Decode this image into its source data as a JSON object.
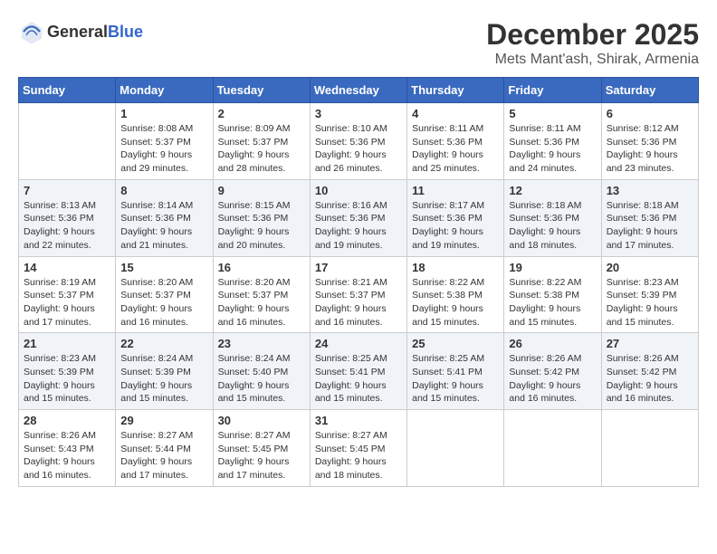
{
  "logo": {
    "general": "General",
    "blue": "Blue"
  },
  "title": "December 2025",
  "subtitle": "Mets Mant'ash, Shirak, Armenia",
  "days_of_week": [
    "Sunday",
    "Monday",
    "Tuesday",
    "Wednesday",
    "Thursday",
    "Friday",
    "Saturday"
  ],
  "weeks": [
    [
      {
        "day": "",
        "sunrise": "",
        "sunset": "",
        "daylight": ""
      },
      {
        "day": "1",
        "sunrise": "Sunrise: 8:08 AM",
        "sunset": "Sunset: 5:37 PM",
        "daylight": "Daylight: 9 hours and 29 minutes."
      },
      {
        "day": "2",
        "sunrise": "Sunrise: 8:09 AM",
        "sunset": "Sunset: 5:37 PM",
        "daylight": "Daylight: 9 hours and 28 minutes."
      },
      {
        "day": "3",
        "sunrise": "Sunrise: 8:10 AM",
        "sunset": "Sunset: 5:36 PM",
        "daylight": "Daylight: 9 hours and 26 minutes."
      },
      {
        "day": "4",
        "sunrise": "Sunrise: 8:11 AM",
        "sunset": "Sunset: 5:36 PM",
        "daylight": "Daylight: 9 hours and 25 minutes."
      },
      {
        "day": "5",
        "sunrise": "Sunrise: 8:11 AM",
        "sunset": "Sunset: 5:36 PM",
        "daylight": "Daylight: 9 hours and 24 minutes."
      },
      {
        "day": "6",
        "sunrise": "Sunrise: 8:12 AM",
        "sunset": "Sunset: 5:36 PM",
        "daylight": "Daylight: 9 hours and 23 minutes."
      }
    ],
    [
      {
        "day": "7",
        "sunrise": "Sunrise: 8:13 AM",
        "sunset": "Sunset: 5:36 PM",
        "daylight": "Daylight: 9 hours and 22 minutes."
      },
      {
        "day": "8",
        "sunrise": "Sunrise: 8:14 AM",
        "sunset": "Sunset: 5:36 PM",
        "daylight": "Daylight: 9 hours and 21 minutes."
      },
      {
        "day": "9",
        "sunrise": "Sunrise: 8:15 AM",
        "sunset": "Sunset: 5:36 PM",
        "daylight": "Daylight: 9 hours and 20 minutes."
      },
      {
        "day": "10",
        "sunrise": "Sunrise: 8:16 AM",
        "sunset": "Sunset: 5:36 PM",
        "daylight": "Daylight: 9 hours and 19 minutes."
      },
      {
        "day": "11",
        "sunrise": "Sunrise: 8:17 AM",
        "sunset": "Sunset: 5:36 PM",
        "daylight": "Daylight: 9 hours and 19 minutes."
      },
      {
        "day": "12",
        "sunrise": "Sunrise: 8:18 AM",
        "sunset": "Sunset: 5:36 PM",
        "daylight": "Daylight: 9 hours and 18 minutes."
      },
      {
        "day": "13",
        "sunrise": "Sunrise: 8:18 AM",
        "sunset": "Sunset: 5:36 PM",
        "daylight": "Daylight: 9 hours and 17 minutes."
      }
    ],
    [
      {
        "day": "14",
        "sunrise": "Sunrise: 8:19 AM",
        "sunset": "Sunset: 5:37 PM",
        "daylight": "Daylight: 9 hours and 17 minutes."
      },
      {
        "day": "15",
        "sunrise": "Sunrise: 8:20 AM",
        "sunset": "Sunset: 5:37 PM",
        "daylight": "Daylight: 9 hours and 16 minutes."
      },
      {
        "day": "16",
        "sunrise": "Sunrise: 8:20 AM",
        "sunset": "Sunset: 5:37 PM",
        "daylight": "Daylight: 9 hours and 16 minutes."
      },
      {
        "day": "17",
        "sunrise": "Sunrise: 8:21 AM",
        "sunset": "Sunset: 5:37 PM",
        "daylight": "Daylight: 9 hours and 16 minutes."
      },
      {
        "day": "18",
        "sunrise": "Sunrise: 8:22 AM",
        "sunset": "Sunset: 5:38 PM",
        "daylight": "Daylight: 9 hours and 15 minutes."
      },
      {
        "day": "19",
        "sunrise": "Sunrise: 8:22 AM",
        "sunset": "Sunset: 5:38 PM",
        "daylight": "Daylight: 9 hours and 15 minutes."
      },
      {
        "day": "20",
        "sunrise": "Sunrise: 8:23 AM",
        "sunset": "Sunset: 5:39 PM",
        "daylight": "Daylight: 9 hours and 15 minutes."
      }
    ],
    [
      {
        "day": "21",
        "sunrise": "Sunrise: 8:23 AM",
        "sunset": "Sunset: 5:39 PM",
        "daylight": "Daylight: 9 hours and 15 minutes."
      },
      {
        "day": "22",
        "sunrise": "Sunrise: 8:24 AM",
        "sunset": "Sunset: 5:39 PM",
        "daylight": "Daylight: 9 hours and 15 minutes."
      },
      {
        "day": "23",
        "sunrise": "Sunrise: 8:24 AM",
        "sunset": "Sunset: 5:40 PM",
        "daylight": "Daylight: 9 hours and 15 minutes."
      },
      {
        "day": "24",
        "sunrise": "Sunrise: 8:25 AM",
        "sunset": "Sunset: 5:41 PM",
        "daylight": "Daylight: 9 hours and 15 minutes."
      },
      {
        "day": "25",
        "sunrise": "Sunrise: 8:25 AM",
        "sunset": "Sunset: 5:41 PM",
        "daylight": "Daylight: 9 hours and 15 minutes."
      },
      {
        "day": "26",
        "sunrise": "Sunrise: 8:26 AM",
        "sunset": "Sunset: 5:42 PM",
        "daylight": "Daylight: 9 hours and 16 minutes."
      },
      {
        "day": "27",
        "sunrise": "Sunrise: 8:26 AM",
        "sunset": "Sunset: 5:42 PM",
        "daylight": "Daylight: 9 hours and 16 minutes."
      }
    ],
    [
      {
        "day": "28",
        "sunrise": "Sunrise: 8:26 AM",
        "sunset": "Sunset: 5:43 PM",
        "daylight": "Daylight: 9 hours and 16 minutes."
      },
      {
        "day": "29",
        "sunrise": "Sunrise: 8:27 AM",
        "sunset": "Sunset: 5:44 PM",
        "daylight": "Daylight: 9 hours and 17 minutes."
      },
      {
        "day": "30",
        "sunrise": "Sunrise: 8:27 AM",
        "sunset": "Sunset: 5:45 PM",
        "daylight": "Daylight: 9 hours and 17 minutes."
      },
      {
        "day": "31",
        "sunrise": "Sunrise: 8:27 AM",
        "sunset": "Sunset: 5:45 PM",
        "daylight": "Daylight: 9 hours and 18 minutes."
      },
      {
        "day": "",
        "sunrise": "",
        "sunset": "",
        "daylight": ""
      },
      {
        "day": "",
        "sunrise": "",
        "sunset": "",
        "daylight": ""
      },
      {
        "day": "",
        "sunrise": "",
        "sunset": "",
        "daylight": ""
      }
    ]
  ]
}
